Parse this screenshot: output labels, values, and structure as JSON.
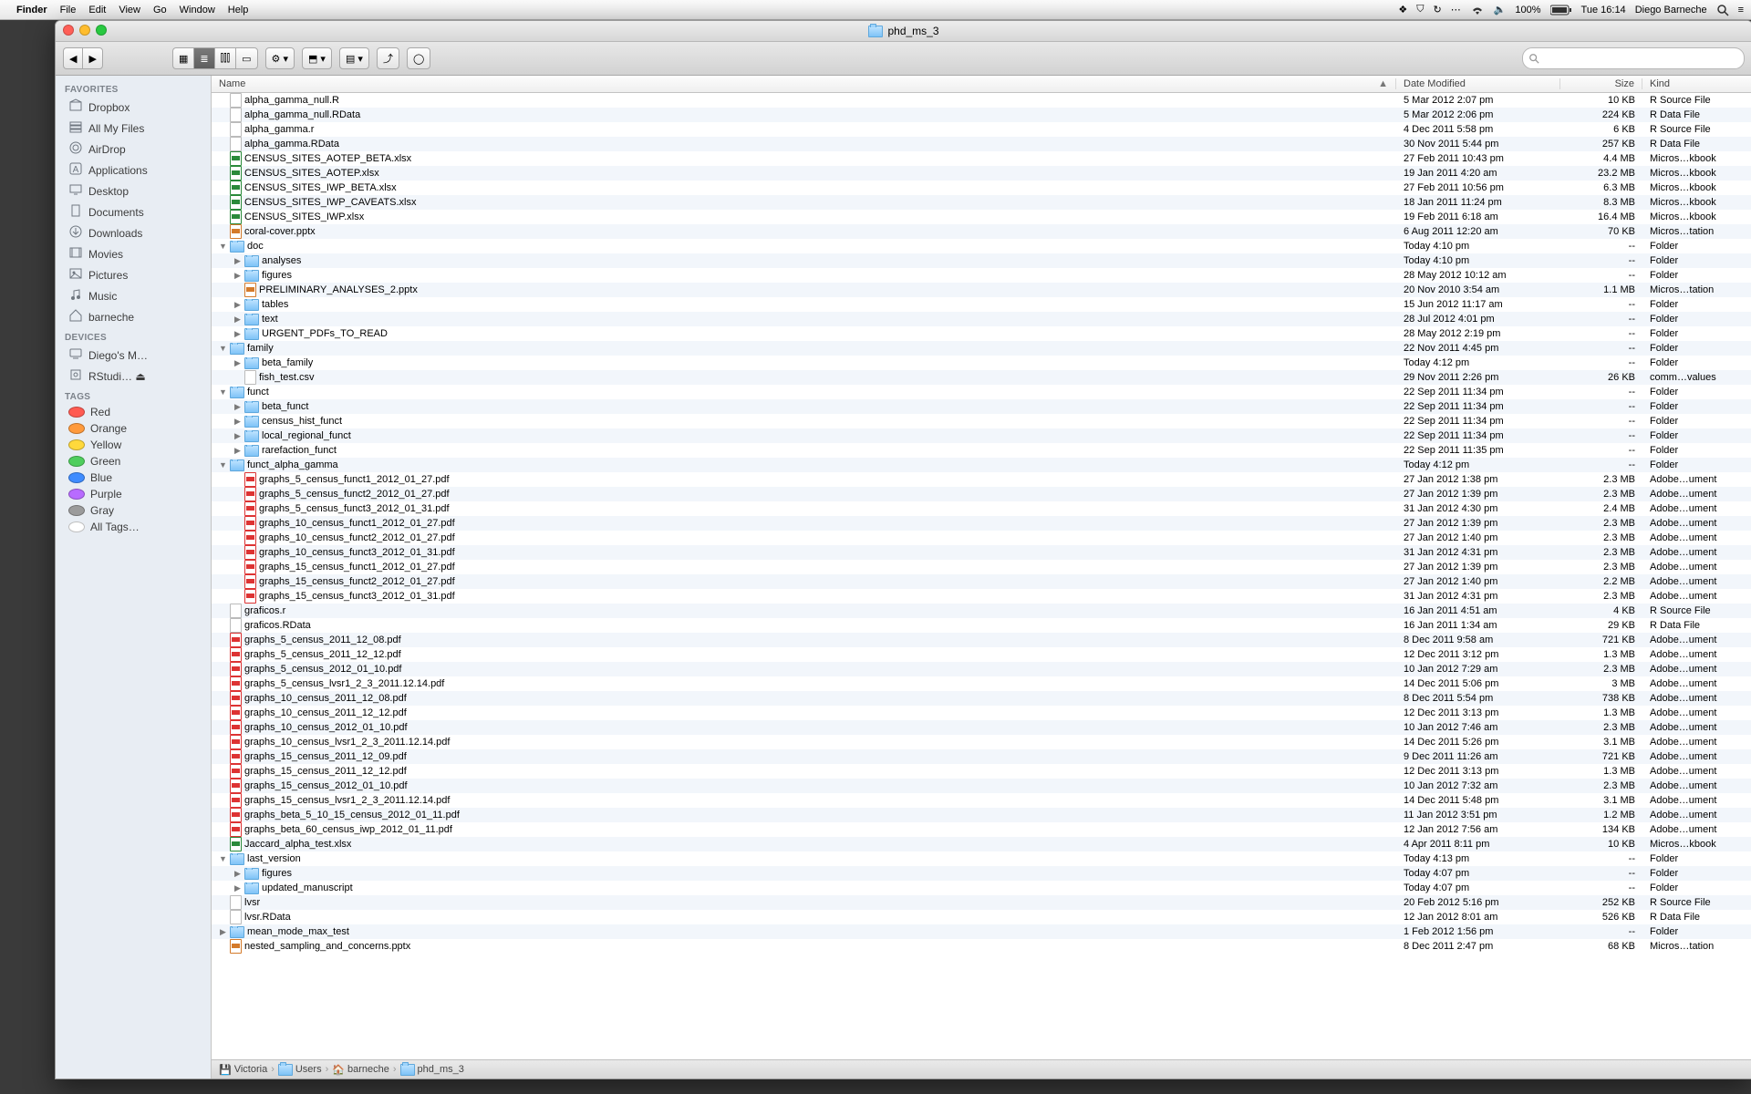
{
  "menubar": {
    "app": "Finder",
    "items": [
      "File",
      "Edit",
      "View",
      "Go",
      "Window",
      "Help"
    ],
    "battery": "100%",
    "clock": "Tue 16:14",
    "user": "Diego Barneche"
  },
  "window": {
    "title": "phd_ms_3",
    "search_placeholder": "",
    "columns": {
      "name": "Name",
      "date": "Date Modified",
      "size": "Size",
      "kind": "Kind"
    },
    "path": [
      "Victoria",
      "Users",
      "barneche",
      "phd_ms_3"
    ]
  },
  "sidebar": {
    "favorites_header": "FAVORITES",
    "favorites": [
      {
        "label": "Dropbox",
        "icon": "box"
      },
      {
        "label": "All My Files",
        "icon": "stack"
      },
      {
        "label": "AirDrop",
        "icon": "airdrop"
      },
      {
        "label": "Applications",
        "icon": "app"
      },
      {
        "label": "Desktop",
        "icon": "desktop"
      },
      {
        "label": "Documents",
        "icon": "doc"
      },
      {
        "label": "Downloads",
        "icon": "down"
      },
      {
        "label": "Movies",
        "icon": "movie"
      },
      {
        "label": "Pictures",
        "icon": "pic"
      },
      {
        "label": "Music",
        "icon": "music"
      },
      {
        "label": "barneche",
        "icon": "home"
      }
    ],
    "devices_header": "DEVICES",
    "devices": [
      {
        "label": "Diego's M…",
        "icon": "mac"
      },
      {
        "label": "RStudi… ⏏",
        "icon": "disk"
      }
    ],
    "tags_header": "TAGS",
    "tags": [
      {
        "label": "Red",
        "color": "#ff5b52"
      },
      {
        "label": "Orange",
        "color": "#ff9a3c"
      },
      {
        "label": "Yellow",
        "color": "#ffd93c"
      },
      {
        "label": "Green",
        "color": "#4fce5d"
      },
      {
        "label": "Blue",
        "color": "#3f8cff"
      },
      {
        "label": "Purple",
        "color": "#b86bff"
      },
      {
        "label": "Gray",
        "color": "#9b9b9b"
      },
      {
        "label": "All Tags…",
        "color": ""
      }
    ]
  },
  "files": [
    {
      "d": 0,
      "t": "file",
      "n": "alpha_gamma_null.R",
      "dm": "5 Mar 2012 2:07 pm",
      "s": "10 KB",
      "k": "R Source File"
    },
    {
      "d": 0,
      "t": "file",
      "n": "alpha_gamma_null.RData",
      "dm": "5 Mar 2012 2:06 pm",
      "s": "224 KB",
      "k": "R Data File"
    },
    {
      "d": 0,
      "t": "file",
      "n": "alpha_gamma.r",
      "dm": "4 Dec 2011 5:58 pm",
      "s": "6 KB",
      "k": "R Source File"
    },
    {
      "d": 0,
      "t": "file",
      "n": "alpha_gamma.RData",
      "dm": "30 Nov 2011 5:44 pm",
      "s": "257 KB",
      "k": "R Data File"
    },
    {
      "d": 0,
      "t": "xls",
      "n": "CENSUS_SITES_AOTEP_BETA.xlsx",
      "dm": "27 Feb 2011 10:43 pm",
      "s": "4.4 MB",
      "k": "Micros…kbook"
    },
    {
      "d": 0,
      "t": "xls",
      "n": "CENSUS_SITES_AOTEP.xlsx",
      "dm": "19 Jan 2011 4:20 am",
      "s": "23.2 MB",
      "k": "Micros…kbook"
    },
    {
      "d": 0,
      "t": "xls",
      "n": "CENSUS_SITES_IWP_BETA.xlsx",
      "dm": "27 Feb 2011 10:56 pm",
      "s": "6.3 MB",
      "k": "Micros…kbook"
    },
    {
      "d": 0,
      "t": "xls",
      "n": "CENSUS_SITES_IWP_CAVEATS.xlsx",
      "dm": "18 Jan 2011 11:24 pm",
      "s": "8.3 MB",
      "k": "Micros…kbook"
    },
    {
      "d": 0,
      "t": "xls",
      "n": "CENSUS_SITES_IWP.xlsx",
      "dm": "19 Feb 2011 6:18 am",
      "s": "16.4 MB",
      "k": "Micros…kbook"
    },
    {
      "d": 0,
      "t": "ppt",
      "n": "coral-cover.pptx",
      "dm": "6 Aug 2011 12:20 am",
      "s": "70 KB",
      "k": "Micros…tation"
    },
    {
      "d": 0,
      "t": "folder",
      "exp": "open",
      "n": "doc",
      "dm": "Today 4:10 pm",
      "s": "--",
      "k": "Folder"
    },
    {
      "d": 1,
      "t": "folder",
      "exp": "closed",
      "n": "analyses",
      "dm": "Today 4:10 pm",
      "s": "--",
      "k": "Folder"
    },
    {
      "d": 1,
      "t": "folder",
      "exp": "closed",
      "n": "figures",
      "dm": "28 May 2012 10:12 am",
      "s": "--",
      "k": "Folder"
    },
    {
      "d": 1,
      "t": "ppt",
      "n": "PRELIMINARY_ANALYSES_2.pptx",
      "dm": "20 Nov 2010 3:54 am",
      "s": "1.1 MB",
      "k": "Micros…tation"
    },
    {
      "d": 1,
      "t": "folder",
      "exp": "closed",
      "n": "tables",
      "dm": "15 Jun 2012 11:17 am",
      "s": "--",
      "k": "Folder"
    },
    {
      "d": 1,
      "t": "folder",
      "exp": "closed",
      "n": "text",
      "dm": "28 Jul 2012 4:01 pm",
      "s": "--",
      "k": "Folder"
    },
    {
      "d": 1,
      "t": "folder",
      "exp": "closed",
      "n": "URGENT_PDFs_TO_READ",
      "dm": "28 May 2012 2:19 pm",
      "s": "--",
      "k": "Folder"
    },
    {
      "d": 0,
      "t": "folder",
      "exp": "open",
      "n": "family",
      "dm": "22 Nov 2011 4:45 pm",
      "s": "--",
      "k": "Folder"
    },
    {
      "d": 1,
      "t": "folder",
      "exp": "closed",
      "n": "beta_family",
      "dm": "Today 4:12 pm",
      "s": "--",
      "k": "Folder"
    },
    {
      "d": 1,
      "t": "file",
      "n": "fish_test.csv",
      "dm": "29 Nov 2011 2:26 pm",
      "s": "26 KB",
      "k": "comm…values"
    },
    {
      "d": 0,
      "t": "folder",
      "exp": "open",
      "n": "funct",
      "dm": "22 Sep 2011 11:34 pm",
      "s": "--",
      "k": "Folder"
    },
    {
      "d": 1,
      "t": "folder",
      "exp": "closed",
      "n": "beta_funct",
      "dm": "22 Sep 2011 11:34 pm",
      "s": "--",
      "k": "Folder"
    },
    {
      "d": 1,
      "t": "folder",
      "exp": "closed",
      "n": "census_hist_funct",
      "dm": "22 Sep 2011 11:34 pm",
      "s": "--",
      "k": "Folder"
    },
    {
      "d": 1,
      "t": "folder",
      "exp": "closed",
      "n": "local_regional_funct",
      "dm": "22 Sep 2011 11:34 pm",
      "s": "--",
      "k": "Folder"
    },
    {
      "d": 1,
      "t": "folder",
      "exp": "closed",
      "n": "rarefaction_funct",
      "dm": "22 Sep 2011 11:35 pm",
      "s": "--",
      "k": "Folder"
    },
    {
      "d": 0,
      "t": "folder",
      "exp": "open",
      "n": "funct_alpha_gamma",
      "dm": "Today 4:12 pm",
      "s": "--",
      "k": "Folder"
    },
    {
      "d": 1,
      "t": "pdf",
      "n": "graphs_5_census_funct1_2012_01_27.pdf",
      "dm": "27 Jan 2012 1:38 pm",
      "s": "2.3 MB",
      "k": "Adobe…ument"
    },
    {
      "d": 1,
      "t": "pdf",
      "n": "graphs_5_census_funct2_2012_01_27.pdf",
      "dm": "27 Jan 2012 1:39 pm",
      "s": "2.3 MB",
      "k": "Adobe…ument"
    },
    {
      "d": 1,
      "t": "pdf",
      "n": "graphs_5_census_funct3_2012_01_31.pdf",
      "dm": "31 Jan 2012 4:30 pm",
      "s": "2.4 MB",
      "k": "Adobe…ument"
    },
    {
      "d": 1,
      "t": "pdf",
      "n": "graphs_10_census_funct1_2012_01_27.pdf",
      "dm": "27 Jan 2012 1:39 pm",
      "s": "2.3 MB",
      "k": "Adobe…ument"
    },
    {
      "d": 1,
      "t": "pdf",
      "n": "graphs_10_census_funct2_2012_01_27.pdf",
      "dm": "27 Jan 2012 1:40 pm",
      "s": "2.3 MB",
      "k": "Adobe…ument"
    },
    {
      "d": 1,
      "t": "pdf",
      "n": "graphs_10_census_funct3_2012_01_31.pdf",
      "dm": "31 Jan 2012 4:31 pm",
      "s": "2.3 MB",
      "k": "Adobe…ument"
    },
    {
      "d": 1,
      "t": "pdf",
      "n": "graphs_15_census_funct1_2012_01_27.pdf",
      "dm": "27 Jan 2012 1:39 pm",
      "s": "2.3 MB",
      "k": "Adobe…ument"
    },
    {
      "d": 1,
      "t": "pdf",
      "n": "graphs_15_census_funct2_2012_01_27.pdf",
      "dm": "27 Jan 2012 1:40 pm",
      "s": "2.2 MB",
      "k": "Adobe…ument"
    },
    {
      "d": 1,
      "t": "pdf",
      "n": "graphs_15_census_funct3_2012_01_31.pdf",
      "dm": "31 Jan 2012 4:31 pm",
      "s": "2.3 MB",
      "k": "Adobe…ument"
    },
    {
      "d": 0,
      "t": "file",
      "n": "graficos.r",
      "dm": "16 Jan 2011 4:51 am",
      "s": "4 KB",
      "k": "R Source File"
    },
    {
      "d": 0,
      "t": "file",
      "n": "graficos.RData",
      "dm": "16 Jan 2011 1:34 am",
      "s": "29 KB",
      "k": "R Data File"
    },
    {
      "d": 0,
      "t": "pdf",
      "n": "graphs_5_census_2011_12_08.pdf",
      "dm": "8 Dec 2011 9:58 am",
      "s": "721 KB",
      "k": "Adobe…ument"
    },
    {
      "d": 0,
      "t": "pdf",
      "n": "graphs_5_census_2011_12_12.pdf",
      "dm": "12 Dec 2011 3:12 pm",
      "s": "1.3 MB",
      "k": "Adobe…ument"
    },
    {
      "d": 0,
      "t": "pdf",
      "n": "graphs_5_census_2012_01_10.pdf",
      "dm": "10 Jan 2012 7:29 am",
      "s": "2.3 MB",
      "k": "Adobe…ument"
    },
    {
      "d": 0,
      "t": "pdf",
      "n": "graphs_5_census_lvsr1_2_3_2011.12.14.pdf",
      "dm": "14 Dec 2011 5:06 pm",
      "s": "3 MB",
      "k": "Adobe…ument"
    },
    {
      "d": 0,
      "t": "pdf",
      "n": "graphs_10_census_2011_12_08.pdf",
      "dm": "8 Dec 2011 5:54 pm",
      "s": "738 KB",
      "k": "Adobe…ument"
    },
    {
      "d": 0,
      "t": "pdf",
      "n": "graphs_10_census_2011_12_12.pdf",
      "dm": "12 Dec 2011 3:13 pm",
      "s": "1.3 MB",
      "k": "Adobe…ument"
    },
    {
      "d": 0,
      "t": "pdf",
      "n": "graphs_10_census_2012_01_10.pdf",
      "dm": "10 Jan 2012 7:46 am",
      "s": "2.3 MB",
      "k": "Adobe…ument"
    },
    {
      "d": 0,
      "t": "pdf",
      "n": "graphs_10_census_lvsr1_2_3_2011.12.14.pdf",
      "dm": "14 Dec 2011 5:26 pm",
      "s": "3.1 MB",
      "k": "Adobe…ument"
    },
    {
      "d": 0,
      "t": "pdf",
      "n": "graphs_15_census_2011_12_09.pdf",
      "dm": "9 Dec 2011 11:26 am",
      "s": "721 KB",
      "k": "Adobe…ument"
    },
    {
      "d": 0,
      "t": "pdf",
      "n": "graphs_15_census_2011_12_12.pdf",
      "dm": "12 Dec 2011 3:13 pm",
      "s": "1.3 MB",
      "k": "Adobe…ument"
    },
    {
      "d": 0,
      "t": "pdf",
      "n": "graphs_15_census_2012_01_10.pdf",
      "dm": "10 Jan 2012 7:32 am",
      "s": "2.3 MB",
      "k": "Adobe…ument"
    },
    {
      "d": 0,
      "t": "pdf",
      "n": "graphs_15_census_lvsr1_2_3_2011.12.14.pdf",
      "dm": "14 Dec 2011 5:48 pm",
      "s": "3.1 MB",
      "k": "Adobe…ument"
    },
    {
      "d": 0,
      "t": "pdf",
      "n": "graphs_beta_5_10_15_census_2012_01_11.pdf",
      "dm": "11 Jan 2012 3:51 pm",
      "s": "1.2 MB",
      "k": "Adobe…ument"
    },
    {
      "d": 0,
      "t": "pdf",
      "n": "graphs_beta_60_census_iwp_2012_01_11.pdf",
      "dm": "12 Jan 2012 7:56 am",
      "s": "134 KB",
      "k": "Adobe…ument"
    },
    {
      "d": 0,
      "t": "xls",
      "n": "Jaccard_alpha_test.xlsx",
      "dm": "4 Apr 2011 8:11 pm",
      "s": "10 KB",
      "k": "Micros…kbook"
    },
    {
      "d": 0,
      "t": "folder",
      "exp": "open",
      "n": "last_version",
      "dm": "Today 4:13 pm",
      "s": "--",
      "k": "Folder"
    },
    {
      "d": 1,
      "t": "folder",
      "exp": "closed",
      "n": "figures",
      "dm": "Today 4:07 pm",
      "s": "--",
      "k": "Folder"
    },
    {
      "d": 1,
      "t": "folder",
      "exp": "closed",
      "n": "updated_manuscript",
      "dm": "Today 4:07 pm",
      "s": "--",
      "k": "Folder"
    },
    {
      "d": 0,
      "t": "file",
      "n": "lvsr",
      "dm": "20 Feb 2012 5:16 pm",
      "s": "252 KB",
      "k": "R Source File"
    },
    {
      "d": 0,
      "t": "file",
      "n": "lvsr.RData",
      "dm": "12 Jan 2012 8:01 am",
      "s": "526 KB",
      "k": "R Data File"
    },
    {
      "d": 0,
      "t": "folder",
      "exp": "closed",
      "n": "mean_mode_max_test",
      "dm": "1 Feb 2012 1:56 pm",
      "s": "--",
      "k": "Folder"
    },
    {
      "d": 0,
      "t": "ppt",
      "n": "nested_sampling_and_concerns.pptx",
      "dm": "8 Dec 2011 2:47 pm",
      "s": "68 KB",
      "k": "Micros…tation"
    }
  ]
}
